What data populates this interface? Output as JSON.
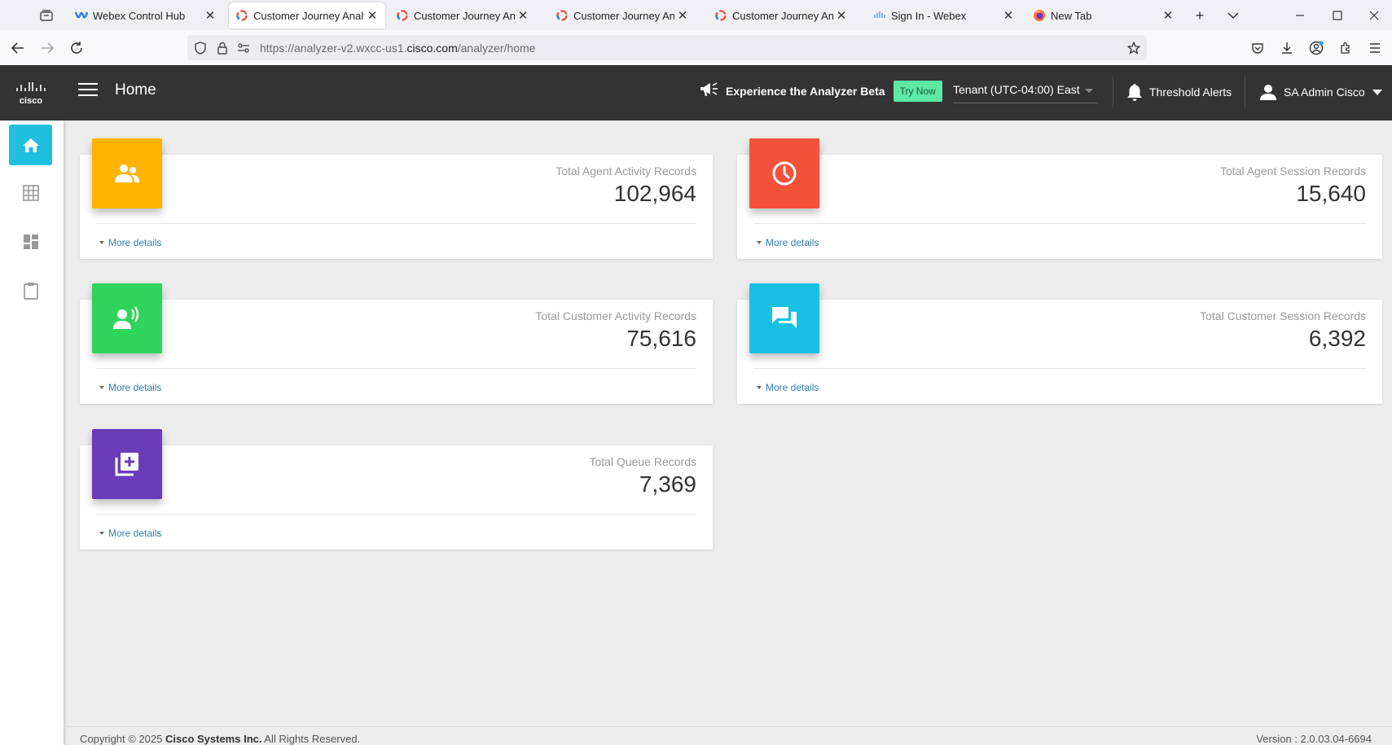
{
  "browser": {
    "tabs": [
      {
        "title": "Webex Control Hub",
        "favicon": "webex-icon",
        "active": false
      },
      {
        "title": "Customer Journey Analyzer",
        "favicon": "analyzer-icon",
        "active": true
      },
      {
        "title": "Customer Journey Analyzer",
        "favicon": "analyzer-icon",
        "active": false
      },
      {
        "title": "Customer Journey Analyzer",
        "favicon": "analyzer-icon",
        "active": false
      },
      {
        "title": "Customer Journey Analyzer",
        "favicon": "analyzer-icon",
        "active": false
      },
      {
        "title": "Sign In - Webex",
        "favicon": "cisco-icon",
        "active": false
      },
      {
        "title": "New Tab",
        "favicon": "firefox-icon",
        "active": false
      }
    ],
    "url": {
      "prefix": "https://analyzer-v2.wxcc-us1.",
      "domain": "cisco.com",
      "path": "/analyzer/home"
    }
  },
  "header": {
    "title": "Home",
    "beta_text": "Experience the Analyzer Beta",
    "try_now": "Try Now",
    "tenant": "Tenant (UTC-04:00) East",
    "threshold_alerts": "Threshold Alerts",
    "user_name": "SA Admin Cisco"
  },
  "sidebar": {
    "items": [
      {
        "icon": "home-icon",
        "active": true
      },
      {
        "icon": "grid-icon",
        "active": false
      },
      {
        "icon": "dashboard-icon",
        "active": false
      },
      {
        "icon": "clipboard-icon",
        "active": false
      }
    ]
  },
  "cards": [
    {
      "label": "Total Agent Activity Records",
      "value": "102,964",
      "more": "More details",
      "icon": "agents-icon",
      "color": "#ffb300"
    },
    {
      "label": "Total Agent Session Records",
      "value": "15,640",
      "more": "More details",
      "icon": "clock-icon",
      "color": "#f4513b"
    },
    {
      "label": "Total Customer Activity Records",
      "value": "75,616",
      "more": "More details",
      "icon": "customer-voice-icon",
      "color": "#2fd45a"
    },
    {
      "label": "Total Customer Session Records",
      "value": "6,392",
      "more": "More details",
      "icon": "chat-icon",
      "color": "#16c1e3"
    },
    {
      "label": "Total Queue Records",
      "value": "7,369",
      "more": "More details",
      "icon": "queue-add-icon",
      "color": "#6a3cb8"
    }
  ],
  "footer": {
    "copyright_prefix": "Copyright © 2025",
    "company": "Cisco Systems Inc.",
    "rights": "All Rights Reserved.",
    "version": "Version : 2.0.03.04-6694"
  }
}
